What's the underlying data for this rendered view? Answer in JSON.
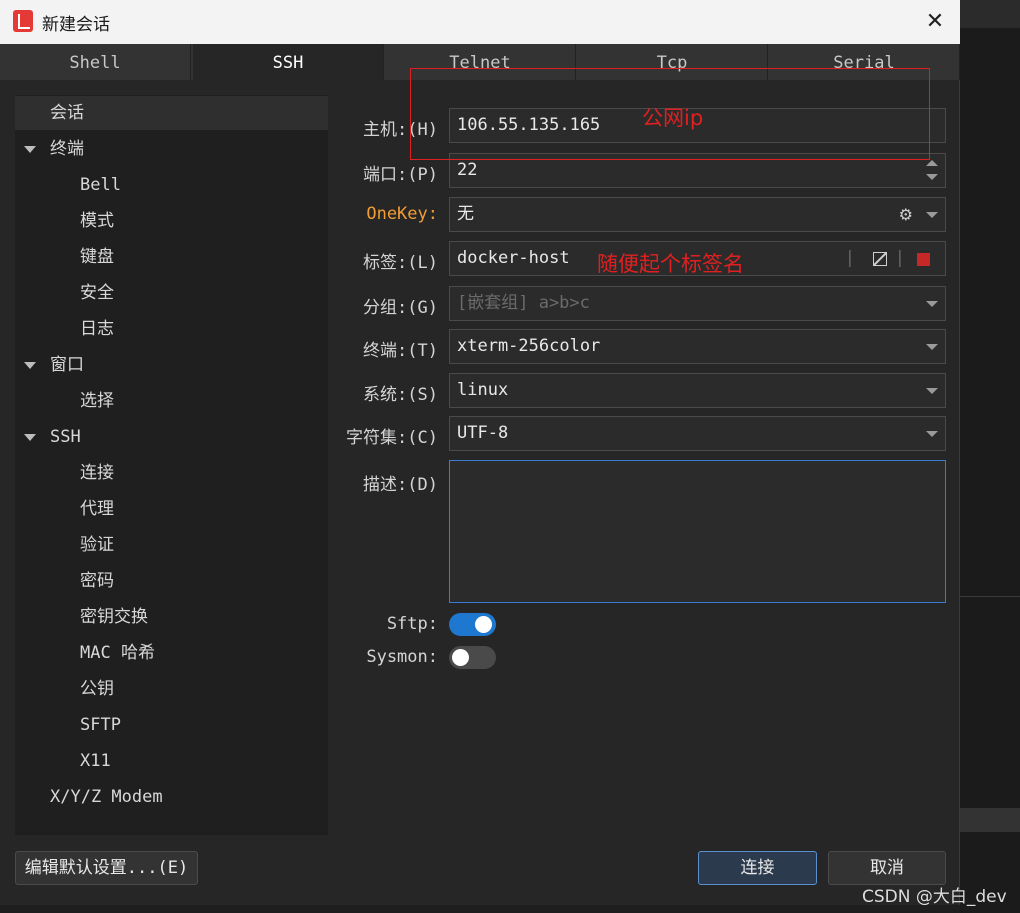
{
  "window": {
    "title": "新建会话",
    "close_glyph": "✕"
  },
  "tabs": [
    {
      "label": "Shell"
    },
    {
      "label": "SSH"
    },
    {
      "label": "Telnet"
    },
    {
      "label": "Tcp"
    },
    {
      "label": "Serial"
    }
  ],
  "sidebar": {
    "items": [
      {
        "label": "会话"
      },
      {
        "label": "终端"
      },
      {
        "label": "Bell"
      },
      {
        "label": "模式"
      },
      {
        "label": "键盘"
      },
      {
        "label": "安全"
      },
      {
        "label": "日志"
      },
      {
        "label": "窗口"
      },
      {
        "label": "选择"
      },
      {
        "label": "SSH"
      },
      {
        "label": "连接"
      },
      {
        "label": "代理"
      },
      {
        "label": "验证"
      },
      {
        "label": "密码"
      },
      {
        "label": "密钥交换"
      },
      {
        "label": "MAC 哈希"
      },
      {
        "label": "公钥"
      },
      {
        "label": "SFTP"
      },
      {
        "label": "X11"
      },
      {
        "label": "X/Y/Z Modem"
      }
    ]
  },
  "form": {
    "host": {
      "label": "主机:(H)",
      "value": "106.55.135.165"
    },
    "port": {
      "label": "端口:(P)",
      "value": "22"
    },
    "onekey": {
      "label": "OneKey:",
      "value": "无"
    },
    "tag": {
      "label": "标签:(L)",
      "value": "docker-host"
    },
    "group": {
      "label": "分组:(G)",
      "placeholder": "[嵌套组] a>b>c"
    },
    "terminal": {
      "label": "终端:(T)",
      "value": "xterm-256color"
    },
    "system": {
      "label": "系统:(S)",
      "value": "linux"
    },
    "charset": {
      "label": "字符集:(C)",
      "value": "UTF-8"
    },
    "description": {
      "label": "描述:(D)",
      "value": ""
    },
    "sftp": {
      "label": "Sftp:",
      "on": true
    },
    "sysmon": {
      "label": "Sysmon:",
      "on": false
    }
  },
  "footer": {
    "edit_defaults_label": "编辑默认设置...(E)",
    "connect_label": "连接",
    "cancel_label": "取消"
  },
  "annotations": {
    "host_note": "公网ip",
    "tag_note": "随便起个标签名"
  },
  "watermark": "CSDN @大白_dev",
  "colors": {
    "accent": "#1e78d0",
    "annotation": "#e02020",
    "onekey_label": "#f39c34",
    "tag_color": "#c62828"
  }
}
